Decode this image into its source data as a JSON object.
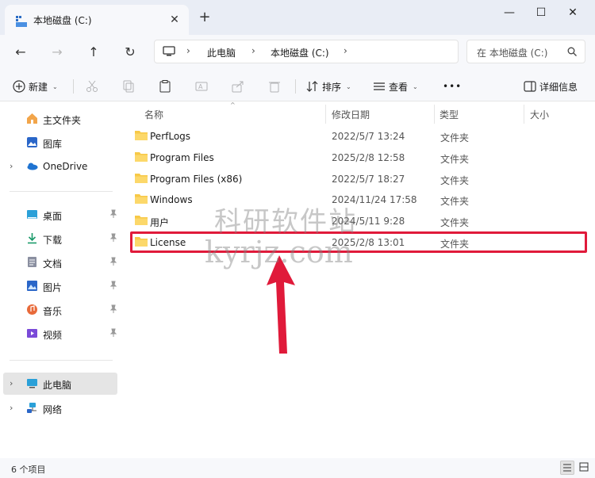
{
  "window": {
    "tab_title": "本地磁盘 (C:)",
    "new_tab": "+",
    "close_tab": "✕"
  },
  "address": {
    "crumbs": [
      "此电脑",
      "本地磁盘 (C:)"
    ],
    "search_placeholder": "在 本地磁盘 (C:)"
  },
  "toolbar": {
    "new_label": "新建",
    "sort_label": "排序",
    "view_label": "查看",
    "more_label": "•••",
    "details_label": "详细信息"
  },
  "sidebar": {
    "items": [
      {
        "label": "主文件夹",
        "icon": "home-icon"
      },
      {
        "label": "图库",
        "icon": "gallery-icon"
      },
      {
        "label": "OneDrive",
        "icon": "onedrive-icon"
      },
      {
        "label": "桌面",
        "icon": "desktop-icon"
      },
      {
        "label": "下载",
        "icon": "download-icon"
      },
      {
        "label": "文档",
        "icon": "document-icon"
      },
      {
        "label": "图片",
        "icon": "picture-icon"
      },
      {
        "label": "音乐",
        "icon": "music-icon"
      },
      {
        "label": "视频",
        "icon": "video-icon"
      },
      {
        "label": "此电脑",
        "icon": "this-pc-icon"
      },
      {
        "label": "网络",
        "icon": "network-icon"
      }
    ]
  },
  "columns": {
    "name": "名称",
    "date": "修改日期",
    "type": "类型",
    "size": "大小"
  },
  "files": [
    {
      "name": "PerfLogs",
      "date": "2022/5/7 13:24",
      "type": "文件夹"
    },
    {
      "name": "Program Files",
      "date": "2025/2/8 12:58",
      "type": "文件夹"
    },
    {
      "name": "Program Files (x86)",
      "date": "2022/5/7 18:27",
      "type": "文件夹"
    },
    {
      "name": "Windows",
      "date": "2024/11/24 17:58",
      "type": "文件夹"
    },
    {
      "name": "用户",
      "date": "2024/5/11 9:28",
      "type": "文件夹"
    },
    {
      "name": "License",
      "date": "2025/2/8 13:01",
      "type": "文件夹"
    }
  ],
  "watermark": {
    "title": "科研软件站",
    "url": "kyrjz.com"
  },
  "status": {
    "item_count": "6 个项目"
  },
  "colors": {
    "accent": "#0067c0",
    "highlight": "#e01a3a",
    "folder": "#f7c948"
  }
}
